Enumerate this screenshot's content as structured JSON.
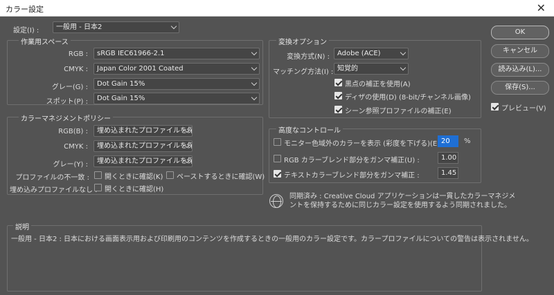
{
  "window": {
    "title": "カラー設定",
    "close_glyph": "✕"
  },
  "settings": {
    "label": "設定(I) :",
    "value": "一般用 - 日本2"
  },
  "workspace": {
    "title": "作業用スペース",
    "rows": [
      {
        "label": "RGB :",
        "value": "sRGB IEC61966-2.1"
      },
      {
        "label": "CMYK :",
        "value": "Japan Color 2001 Coated"
      },
      {
        "label": "グレー(G) :",
        "value": "Dot Gain 15%"
      },
      {
        "label": "スポット(P) :",
        "value": "Dot Gain 15%"
      }
    ]
  },
  "policy": {
    "title": "カラーマネジメントポリシー",
    "rows": [
      {
        "label": "RGB(B) :",
        "value": "埋め込まれたプロファイルを保持"
      },
      {
        "label": "CMYK :",
        "value": "埋め込まれたプロファイルを保持"
      },
      {
        "label": "グレー(Y) :",
        "value": "埋め込まれたプロファイルを保持"
      }
    ],
    "mismatch_label": "プロファイルの不一致 :",
    "mismatch_open": {
      "label": "開くときに確認(K)",
      "checked": false
    },
    "mismatch_paste": {
      "label": "ペーストするときに確認(W)",
      "checked": false
    },
    "missing_label": "埋め込みプロファイルなし :",
    "missing_open": {
      "label": "開くときに確認(H)",
      "checked": false
    }
  },
  "conversion": {
    "title": "変換オプション",
    "engine_label": "変換方式(N) :",
    "engine_value": "Adobe (ACE)",
    "intent_label": "マッチング方法(I) :",
    "intent_value": "知覚的",
    "checks": [
      {
        "label": "黒点の補正を使用(A)",
        "checked": true
      },
      {
        "label": "ディザの使用(D) (8-bit/チャンネル画像)",
        "checked": true
      },
      {
        "label": "シーン参照プロファイルの補正(E)",
        "checked": true
      }
    ]
  },
  "advanced": {
    "title": "高度なコントロール",
    "rows": [
      {
        "label": "モニター色域外のカラーを表示 (彩度を下げる)(E) :",
        "value": "20",
        "unit": "%",
        "checked": false
      },
      {
        "label": "RGB カラーブレンド部分をガンマ補正(U) :",
        "value": "1.00",
        "unit": "",
        "checked": false
      },
      {
        "label": "テキストカラーブレンド部分をガンマ補正 :",
        "value": "1.45",
        "unit": "",
        "checked": true
      }
    ]
  },
  "sync": {
    "line1": "同期済み : Creative Cloud アプリケーションは一貫したカラーマネジメ",
    "line2": "ントを保持するために同じカラー設定を使用するよう同期されました。"
  },
  "buttons": {
    "ok": "OK",
    "cancel": "キャンセル",
    "load": "読み込み(L)...",
    "save": "保存(S)...",
    "preview": {
      "label": "プレビュー(V)",
      "checked": true
    }
  },
  "description": {
    "title": "説明",
    "text": "一般用 - 日本2 : 日本における画面表示用および印刷用のコンテンツを作成するときの一般用のカラー設定です。カラープロファイルについての警告は表示されません。"
  }
}
